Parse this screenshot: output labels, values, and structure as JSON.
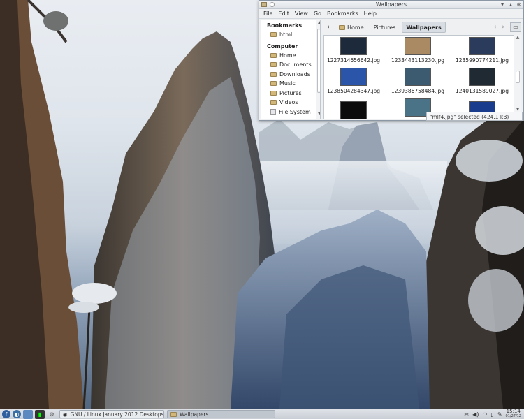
{
  "window": {
    "title": "Wallpapers",
    "menu": [
      "File",
      "Edit",
      "View",
      "Go",
      "Bookmarks",
      "Help"
    ],
    "sidebar": {
      "bookmarks_header": "Bookmarks",
      "bookmarks": [
        "html"
      ],
      "computer_header": "Computer",
      "places": [
        "Home",
        "Documents",
        "Downloads",
        "Music",
        "Pictures",
        "Videos",
        "File System"
      ]
    },
    "path": [
      "Home",
      "Pictures",
      "Wallpapers"
    ],
    "files": [
      {
        "name": "1227314656642.jpg",
        "color": "#1d2a3c"
      },
      {
        "name": "1233443113230.jpg",
        "color": "#a98a62"
      },
      {
        "name": "1235990774211.jpg",
        "color": "#2b3b5c"
      },
      {
        "name": "1238504284347.jpg",
        "color": "#2a55a8"
      },
      {
        "name": "1239386758484.jpg",
        "color": "#3c5a70"
      },
      {
        "name": "1240131589027.jpg",
        "color": "#1f2a33"
      },
      {
        "name": "",
        "color": "#0c0c0c"
      },
      {
        "name": "",
        "color": "#4a7388"
      },
      {
        "name": "",
        "color": "#193d8c"
      }
    ],
    "status": "\"mlf4.jpg\" selected (424.1 kB)"
  },
  "taskbar": {
    "task_desktop": "GNU / Linux January 2012 Desktops",
    "task_window": "Wallpapers",
    "time": "15:14",
    "date": "01/27/12"
  },
  "colors": {
    "window_bg": "#eef0f2",
    "taskbar_bg": "#d4d9df",
    "accent": "#3b6ea5"
  }
}
